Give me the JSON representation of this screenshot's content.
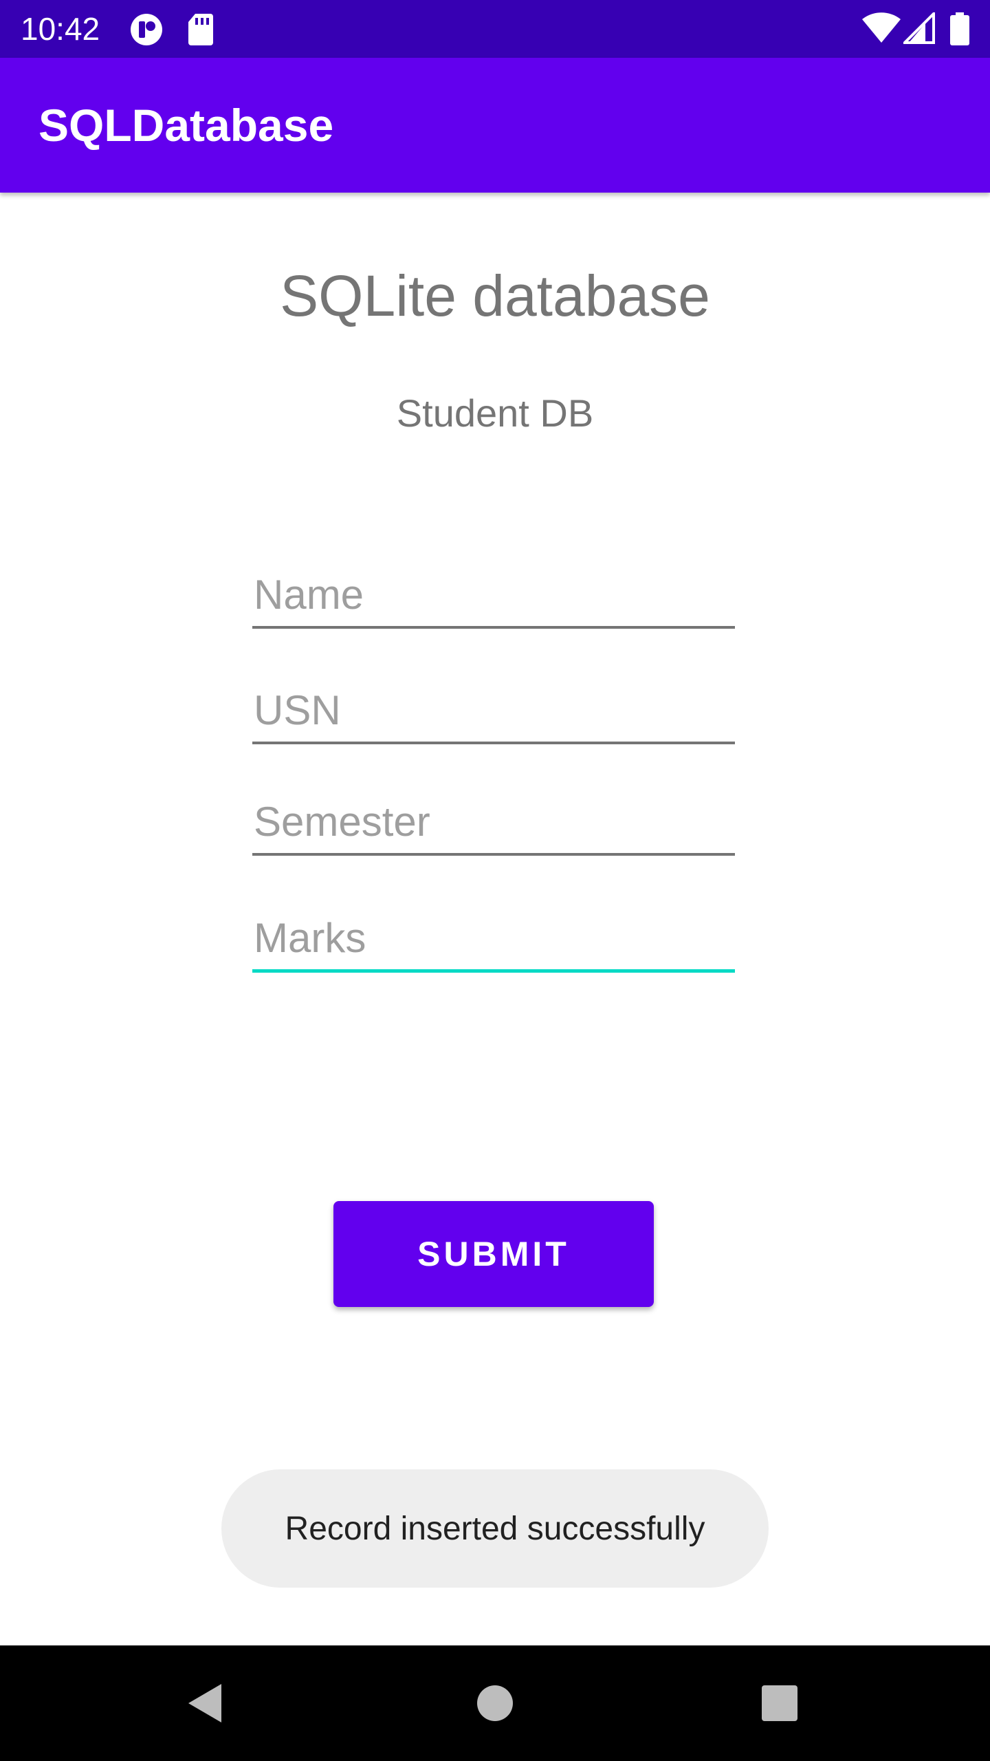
{
  "status_bar": {
    "time": "10:42",
    "left_icons": [
      "app-notification-icon",
      "sd-card-icon"
    ],
    "right_icons": [
      "wifi-icon",
      "signal-icon",
      "battery-icon"
    ]
  },
  "app_bar": {
    "title": "SQLDatabase"
  },
  "main": {
    "heading": "SQLite database",
    "subheading": "Student DB",
    "fields": {
      "name": {
        "placeholder": "Name",
        "value": ""
      },
      "usn": {
        "placeholder": "USN",
        "value": ""
      },
      "semester": {
        "placeholder": "Semester",
        "value": ""
      },
      "marks": {
        "placeholder": "Marks",
        "value": "",
        "focused": true
      }
    },
    "submit_label": "SUBMIT"
  },
  "toast": {
    "message": "Record inserted successfully"
  },
  "nav_bar": {
    "buttons": [
      "back-icon",
      "home-icon",
      "recents-icon"
    ]
  },
  "colors": {
    "status_bar": "#3700b3",
    "primary": "#6200ee",
    "accent": "#03dac5",
    "text_secondary": "#757575"
  }
}
